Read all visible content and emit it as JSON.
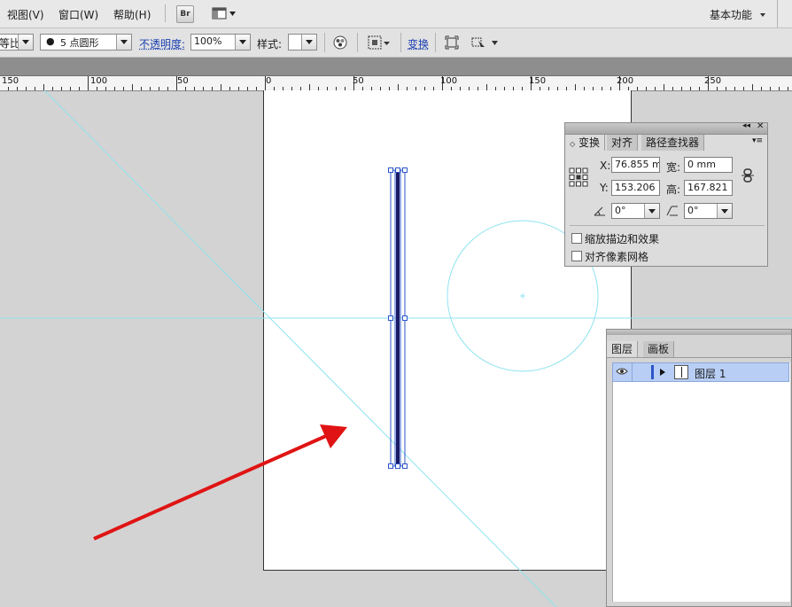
{
  "menubar": {
    "items": [
      "视图(V)",
      "窗口(W)",
      "帮助(H)"
    ],
    "bridge_label": "Br",
    "workspace_label": "基本功能"
  },
  "controlbar": {
    "proportion_fragment": "等比",
    "brush_value": "5 点圆形",
    "opacity_label": "不透明度:",
    "opacity_value": "100%",
    "style_label": "样式:",
    "transform_link": "变换"
  },
  "ruler": {
    "labels": [
      "150",
      "100",
      "50",
      "0",
      "50",
      "100",
      "150",
      "200",
      "250"
    ]
  },
  "transform_panel": {
    "tabs": [
      "变换",
      "对齐",
      "路径查找器"
    ],
    "x_label": "X:",
    "x_value": "76.855 m",
    "w_label": "宽:",
    "w_value": "0 mm",
    "y_label": "Y:",
    "y_value": "153.206",
    "h_label": "高:",
    "h_value": "167.821",
    "rotate_value": "0°",
    "shear_value": "0°",
    "scale_strokes_label": "缩放描边和效果",
    "align_pixel_label": "对齐像素网格"
  },
  "layers_panel": {
    "tabs": [
      "图层",
      "画板"
    ],
    "layer_name": "图层 1"
  },
  "colors": {
    "guide": "#8fe3ef",
    "arrow": "#e01414",
    "selection": "#2b55c8",
    "layer_highlight": "#b8cef4"
  }
}
